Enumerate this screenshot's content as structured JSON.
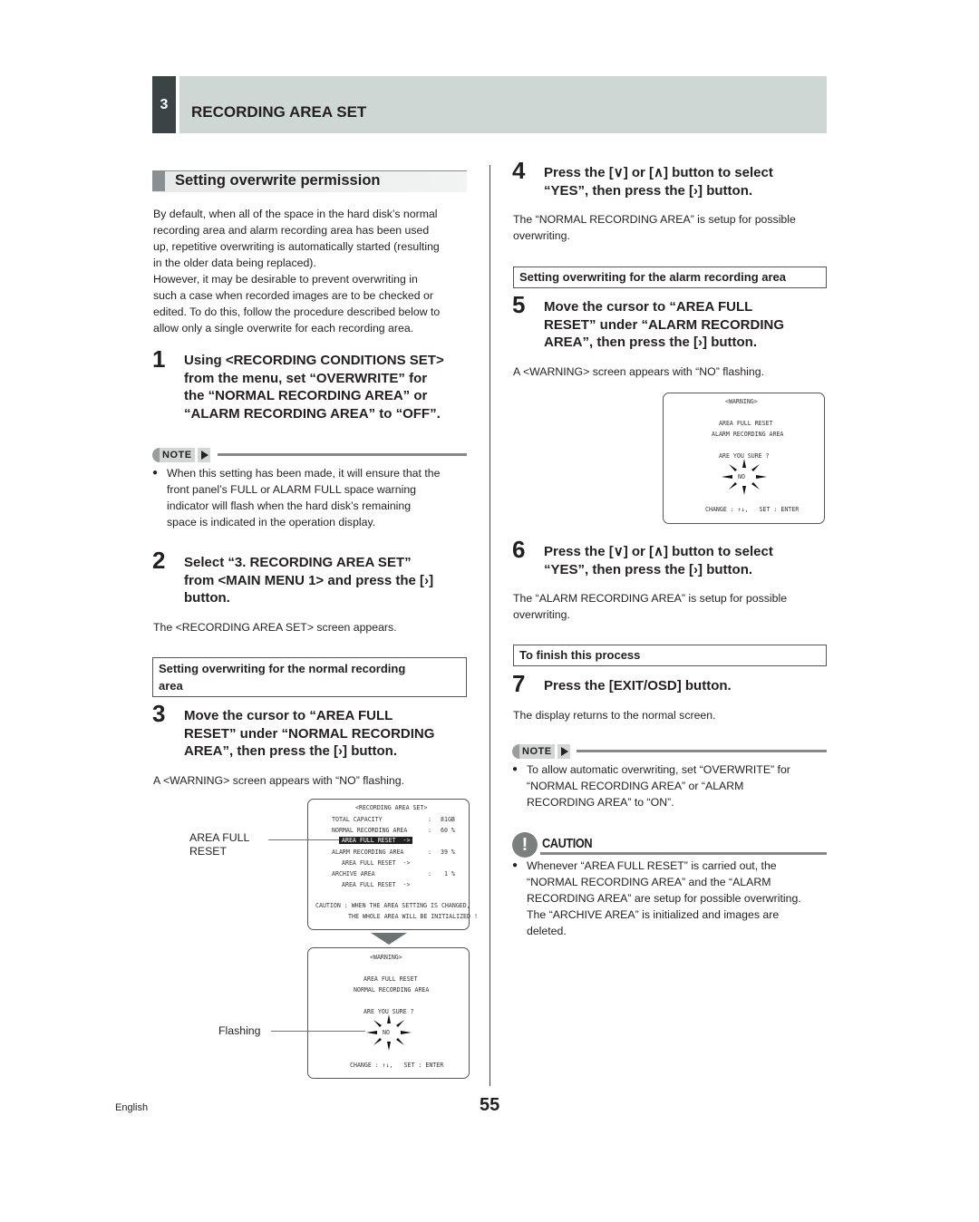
{
  "header": {
    "section_number": "3",
    "title": "RECORDING AREA SET"
  },
  "section": {
    "title": "Setting overwrite permission"
  },
  "intro": {
    "lines": [
      "By default, when all of the space in the hard disk’s normal",
      "recording area and alarm recording area has been used",
      "up, repetitive overwriting is automatically started (resulting",
      "in the older data being replaced).",
      "However, it may be desirable to prevent overwriting in",
      "such a case when recorded images are to be checked or",
      "edited. To do this, follow the procedure described below to",
      "allow only a single overwrite for each recording area."
    ]
  },
  "steps": [
    {
      "number": "1",
      "lines": [
        "Using <RECORDING CONDITIONS SET>",
        "from the menu, set “OVERWRITE” for",
        "the “NORMAL RECORDING AREA” or",
        "“ALARM RECORDING AREA” to “OFF”."
      ]
    },
    {
      "number": "2",
      "lines": [
        "Select “3. RECORDING AREA SET”",
        "from <MAIN MENU 1> and press the [",
        "] ",
        "button."
      ],
      "result": "The <RECORDING AREA SET> screen appears."
    },
    {
      "number": "3",
      "lines": [
        "Move the cursor to “AREA FULL",
        "RESET” under “NORMAL RECORDING",
        "AREA”, then press the [",
        "] button."
      ],
      "result": "A <WARNING> screen appears with “NO” flashing."
    },
    {
      "number": "4",
      "lines": [
        "Press the [",
        "] or [",
        "] button to select",
        "“YES”, then press the [",
        "] button."
      ],
      "result_lines": [
        "The “NORMAL RECORDING AREA” is setup for possible",
        "overwriting."
      ]
    },
    {
      "number": "5",
      "lines": [
        "Move the cursor to “AREA FULL",
        "RESET” under “ALARM RECORDING",
        "AREA”, then press the [",
        "] button."
      ],
      "result": "A <WARNING> screen appears with “NO” flashing."
    },
    {
      "number": "6",
      "lines": [
        "Press the [",
        "] or [",
        "] button to select",
        "“YES”, then press the [",
        "] button."
      ],
      "result_lines": [
        "The “ALARM RECORDING AREA” is setup for possible",
        "overwriting."
      ]
    },
    {
      "number": "7",
      "text": "Press the [EXIT/OSD] button.",
      "result": "The display returns to the normal screen."
    }
  ],
  "glyphs": {
    "down": "∨",
    "up": "∧",
    "right": "›"
  },
  "note1": {
    "label": "NOTE",
    "lines": [
      "When this setting has been made, it will ensure that the",
      "front panel’s FULL or ALARM FULL space warning",
      "indicator will flash when the hard disk’s remaining",
      "space is indicated in the operation display."
    ]
  },
  "box_normal": {
    "lines": [
      "Setting overwriting for the normal recording",
      "area"
    ]
  },
  "box_alarm": {
    "text": "Setting overwriting for the alarm recording area"
  },
  "box_finish": {
    "text": "To finish this process"
  },
  "note2": {
    "label": "NOTE",
    "lines": [
      "To allow automatic overwriting, set “OVERWRITE” for",
      "“NORMAL RECORDING AREA” or “ALARM",
      "RECORDING AREA” to “ON”."
    ]
  },
  "caution": {
    "label": "CAUTION",
    "lines": [
      "Whenever “AREA FULL RESET” is carried out, the",
      "“NORMAL RECORDING AREA” and the “ALARM",
      "RECORDING AREA” are setup for possible overwriting.",
      "The “ARCHIVE AREA” is initialized and images are",
      "deleted."
    ]
  },
  "callouts": {
    "area_full_reset": [
      "AREA FULL",
      "RESET"
    ],
    "flashing": "Flashing"
  },
  "osd_recording_area_set": {
    "title": "<RECORDING AREA SET>",
    "rows": [
      {
        "label": "TOTAL CAPACITY",
        "sep": ":",
        "value": "81GB"
      },
      {
        "label": "NORMAL RECORDING AREA",
        "sep": ":",
        "value": "60 %"
      },
      {
        "label": "AREA FULL RESET  ->",
        "highlighted": true
      },
      {
        "label": "ALARM RECORDING AREA",
        "sep": ":",
        "value": "39 %"
      },
      {
        "label": "AREA FULL RESET  ->"
      },
      {
        "label": "ARCHIVE AREA",
        "sep": ":",
        "value": "1 %"
      },
      {
        "label": "AREA FULL RESET  ->"
      }
    ],
    "caution": [
      "CAUTION : WHEN THE AREA SETTING IS CHANGED,",
      "THE WHOLE AREA WILL BE INITIALIZED !"
    ]
  },
  "osd_warning_normal": {
    "title": "<WARNING>",
    "line1": "AREA FULL RESET",
    "line2": "NORMAL RECORDING AREA",
    "question": "ARE YOU SURE ?",
    "choice": "NO",
    "footer": "CHANGE : ↑↓,   SET : ENTER"
  },
  "osd_warning_alarm": {
    "title": "<WARNING>",
    "line1": "AREA FULL RESET",
    "line2": "ALARM RECORDING AREA",
    "question": "ARE YOU SURE ?",
    "choice": "NO",
    "footer": "CHANGE : ↑↓,   SET : ENTER"
  },
  "footer": {
    "language": "English",
    "page_number": "55"
  }
}
